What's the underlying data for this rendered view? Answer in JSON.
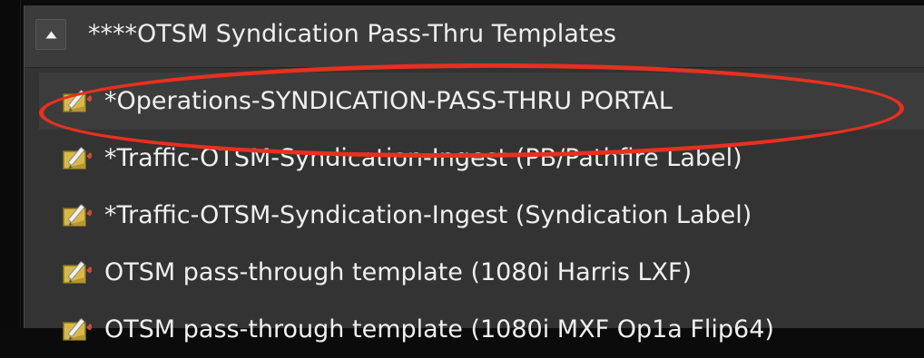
{
  "group": {
    "title": "****OTSM Syndication Pass-Thru Templates",
    "expanded": true,
    "toggle_icon": "caret-up-icon"
  },
  "items": [
    {
      "label": "*Operations-SYNDICATION-PASS-THRU PORTAL",
      "icon": "template-edit-icon",
      "selected": true
    },
    {
      "label": "*Traffic-OTSM-Syndication-Ingest (PB/Pathfire Label)",
      "icon": "template-edit-icon",
      "selected": false
    },
    {
      "label": "*Traffic-OTSM-Syndication-Ingest (Syndication Label)",
      "icon": "template-edit-icon",
      "selected": false
    },
    {
      "label": "OTSM pass-through template (1080i Harris LXF)",
      "icon": "template-edit-icon",
      "selected": false
    },
    {
      "label": "OTSM pass-through template (1080i MXF Op1a Flip64)",
      "icon": "template-edit-icon",
      "selected": false
    }
  ],
  "annotation": {
    "shape": "ellipse",
    "color": "#e8301f",
    "target": "items.0"
  },
  "colors": {
    "panel": "#333333",
    "header": "#3b3b3b",
    "text": "#f0f0f0",
    "icon_body": "#d7b94a"
  }
}
